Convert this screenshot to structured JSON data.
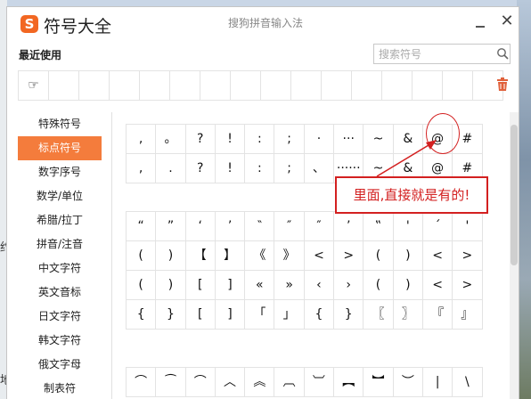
{
  "window": {
    "app_title": "符号大全",
    "logo_glyph": "S",
    "caption": "搜狗拼音输入法",
    "close_glyph": "✕"
  },
  "recent": {
    "label": "最近使用",
    "items": [
      "☞",
      "",
      "",
      "",
      "",
      "",
      "",
      "",
      "",
      "",
      "",
      "",
      "",
      "",
      "",
      ""
    ]
  },
  "search": {
    "placeholder": "搜索符号",
    "value": ""
  },
  "sidebar": {
    "items": [
      {
        "label": "特殊符号",
        "active": false
      },
      {
        "label": "标点符号",
        "active": true
      },
      {
        "label": "数字序号",
        "active": false
      },
      {
        "label": "数学/单位",
        "active": false
      },
      {
        "label": "希腊/拉丁",
        "active": false
      },
      {
        "label": "拼音/注音",
        "active": false
      },
      {
        "label": "中文字符",
        "active": false
      },
      {
        "label": "英文音标",
        "active": false
      },
      {
        "label": "日文字符",
        "active": false
      },
      {
        "label": "韩文字符",
        "active": false
      },
      {
        "label": "俄文字母",
        "active": false
      },
      {
        "label": "制表符",
        "active": false
      }
    ]
  },
  "symbols": {
    "panel1": [
      [
        ",",
        "。",
        "?",
        "!",
        ":",
        ";",
        "·",
        "···",
        "~",
        "&",
        "@",
        "#"
      ],
      [
        ",",
        ".",
        "?",
        "!",
        ":",
        ";",
        "、",
        "······",
        "~",
        "&",
        "@",
        "#"
      ]
    ],
    "panel2": [
      [
        "“",
        "”",
        "‘",
        "’",
        "‶",
        "″",
        "″",
        "’",
        "‟",
        "'",
        "´",
        "'"
      ],
      [
        "(",
        ")",
        "【",
        "】",
        "《",
        "》",
        "<",
        ">",
        "(",
        ")",
        "<",
        ">"
      ],
      [
        "(",
        ")",
        "[",
        "]",
        "«",
        "»",
        "‹",
        "›",
        "(",
        ")",
        "<",
        ">"
      ],
      [
        "{",
        "}",
        "[",
        "]",
        "「",
        "」",
        "{",
        "}",
        "〖",
        "〗",
        "『",
        "』"
      ]
    ],
    "panel3": [
      [
        "⌒",
        "⁀",
        "⌒",
        "︿",
        "︽",
        "︹",
        "︺",
        "︻",
        "︼",
        "︶",
        "|",
        "\\"
      ]
    ]
  },
  "annotation": {
    "text": "里面,直接就是有的!",
    "color": "#d32020"
  },
  "colors": {
    "accent": "#f47c3c",
    "logo": "#f26722"
  },
  "background": {
    "left_text_1": "约",
    "left_text_2": "地"
  }
}
